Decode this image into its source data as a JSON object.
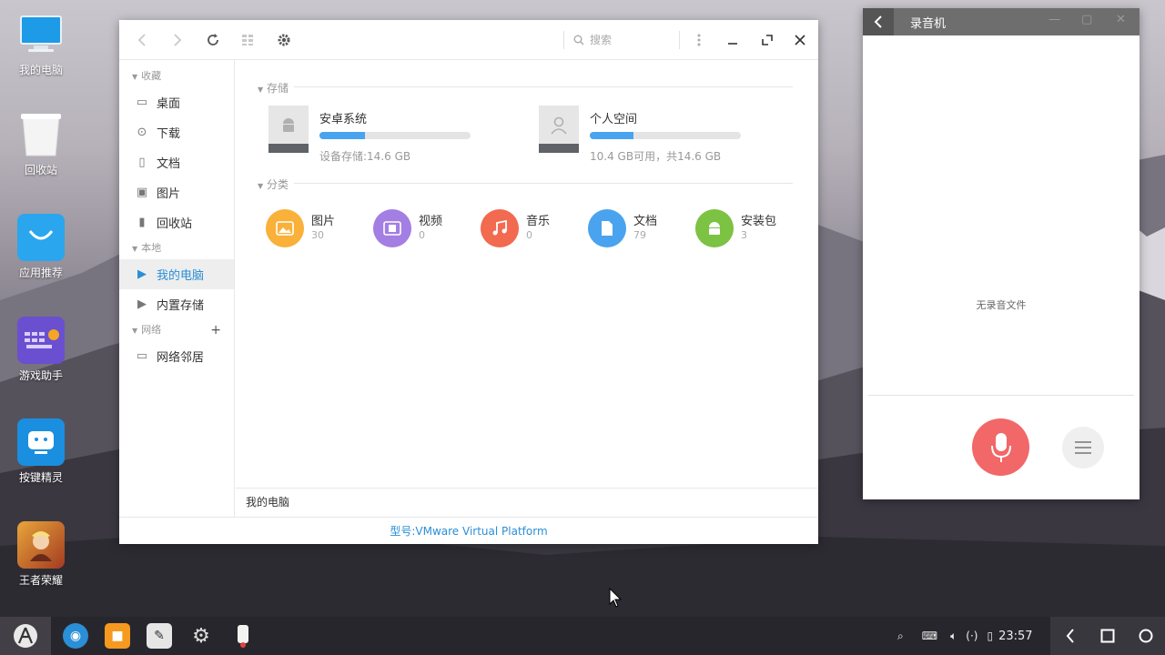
{
  "desktop": {
    "icons": [
      {
        "label": "我的电脑",
        "icon": "computer-icon"
      },
      {
        "label": "回收站",
        "icon": "trash-icon"
      },
      {
        "label": "应用推荐",
        "icon": "store-bag-icon"
      },
      {
        "label": "游戏助手",
        "icon": "game-keyboard-icon"
      },
      {
        "label": "按键精灵",
        "icon": "robot-icon"
      },
      {
        "label": "王者荣耀",
        "icon": "game-hero-icon"
      }
    ]
  },
  "file_manager": {
    "search_placeholder": "搜索",
    "sidebar": {
      "favorites_title": "收藏",
      "favorites": [
        {
          "label": "桌面",
          "icon": "desktop-icon"
        },
        {
          "label": "下载",
          "icon": "download-icon"
        },
        {
          "label": "文档",
          "icon": "document-icon"
        },
        {
          "label": "图片",
          "icon": "image-icon"
        },
        {
          "label": "回收站",
          "icon": "trash-icon"
        }
      ],
      "local_title": "本地",
      "local": [
        {
          "label": "我的电脑",
          "active": true
        },
        {
          "label": "内置存储",
          "active": false
        }
      ],
      "network_title": "网络",
      "network": [
        {
          "label": "网络邻居",
          "icon": "network-icon"
        }
      ]
    },
    "storage_title": "存储",
    "drives": [
      {
        "name": "安卓系统",
        "info": "设备存储:14.6 GB",
        "used_fraction": 0.3,
        "icon": "android-icon"
      },
      {
        "name": "个人空间",
        "info": "10.4 GB可用，共14.6 GB",
        "used_fraction": 0.29,
        "icon": "user-icon"
      }
    ],
    "category_title": "分类",
    "categories": [
      {
        "name": "图片",
        "count": "30",
        "color": "#f9b13a",
        "icon": "image-icon"
      },
      {
        "name": "视频",
        "count": "0",
        "color": "#a37ee3",
        "icon": "video-icon"
      },
      {
        "name": "音乐",
        "count": "0",
        "color": "#f26a4f",
        "icon": "music-icon"
      },
      {
        "name": "文档",
        "count": "79",
        "color": "#4aa3ee",
        "icon": "document-icon"
      },
      {
        "name": "安装包",
        "count": "3",
        "color": "#7cc243",
        "icon": "android-icon"
      }
    ],
    "breadcrumb": "我的电脑",
    "status": "型号:VMware Virtual Platform"
  },
  "recorder": {
    "title": "录音机",
    "empty_text": "无录音文件",
    "accent": "#f26768"
  },
  "taskbar": {
    "clock": "23:57"
  }
}
